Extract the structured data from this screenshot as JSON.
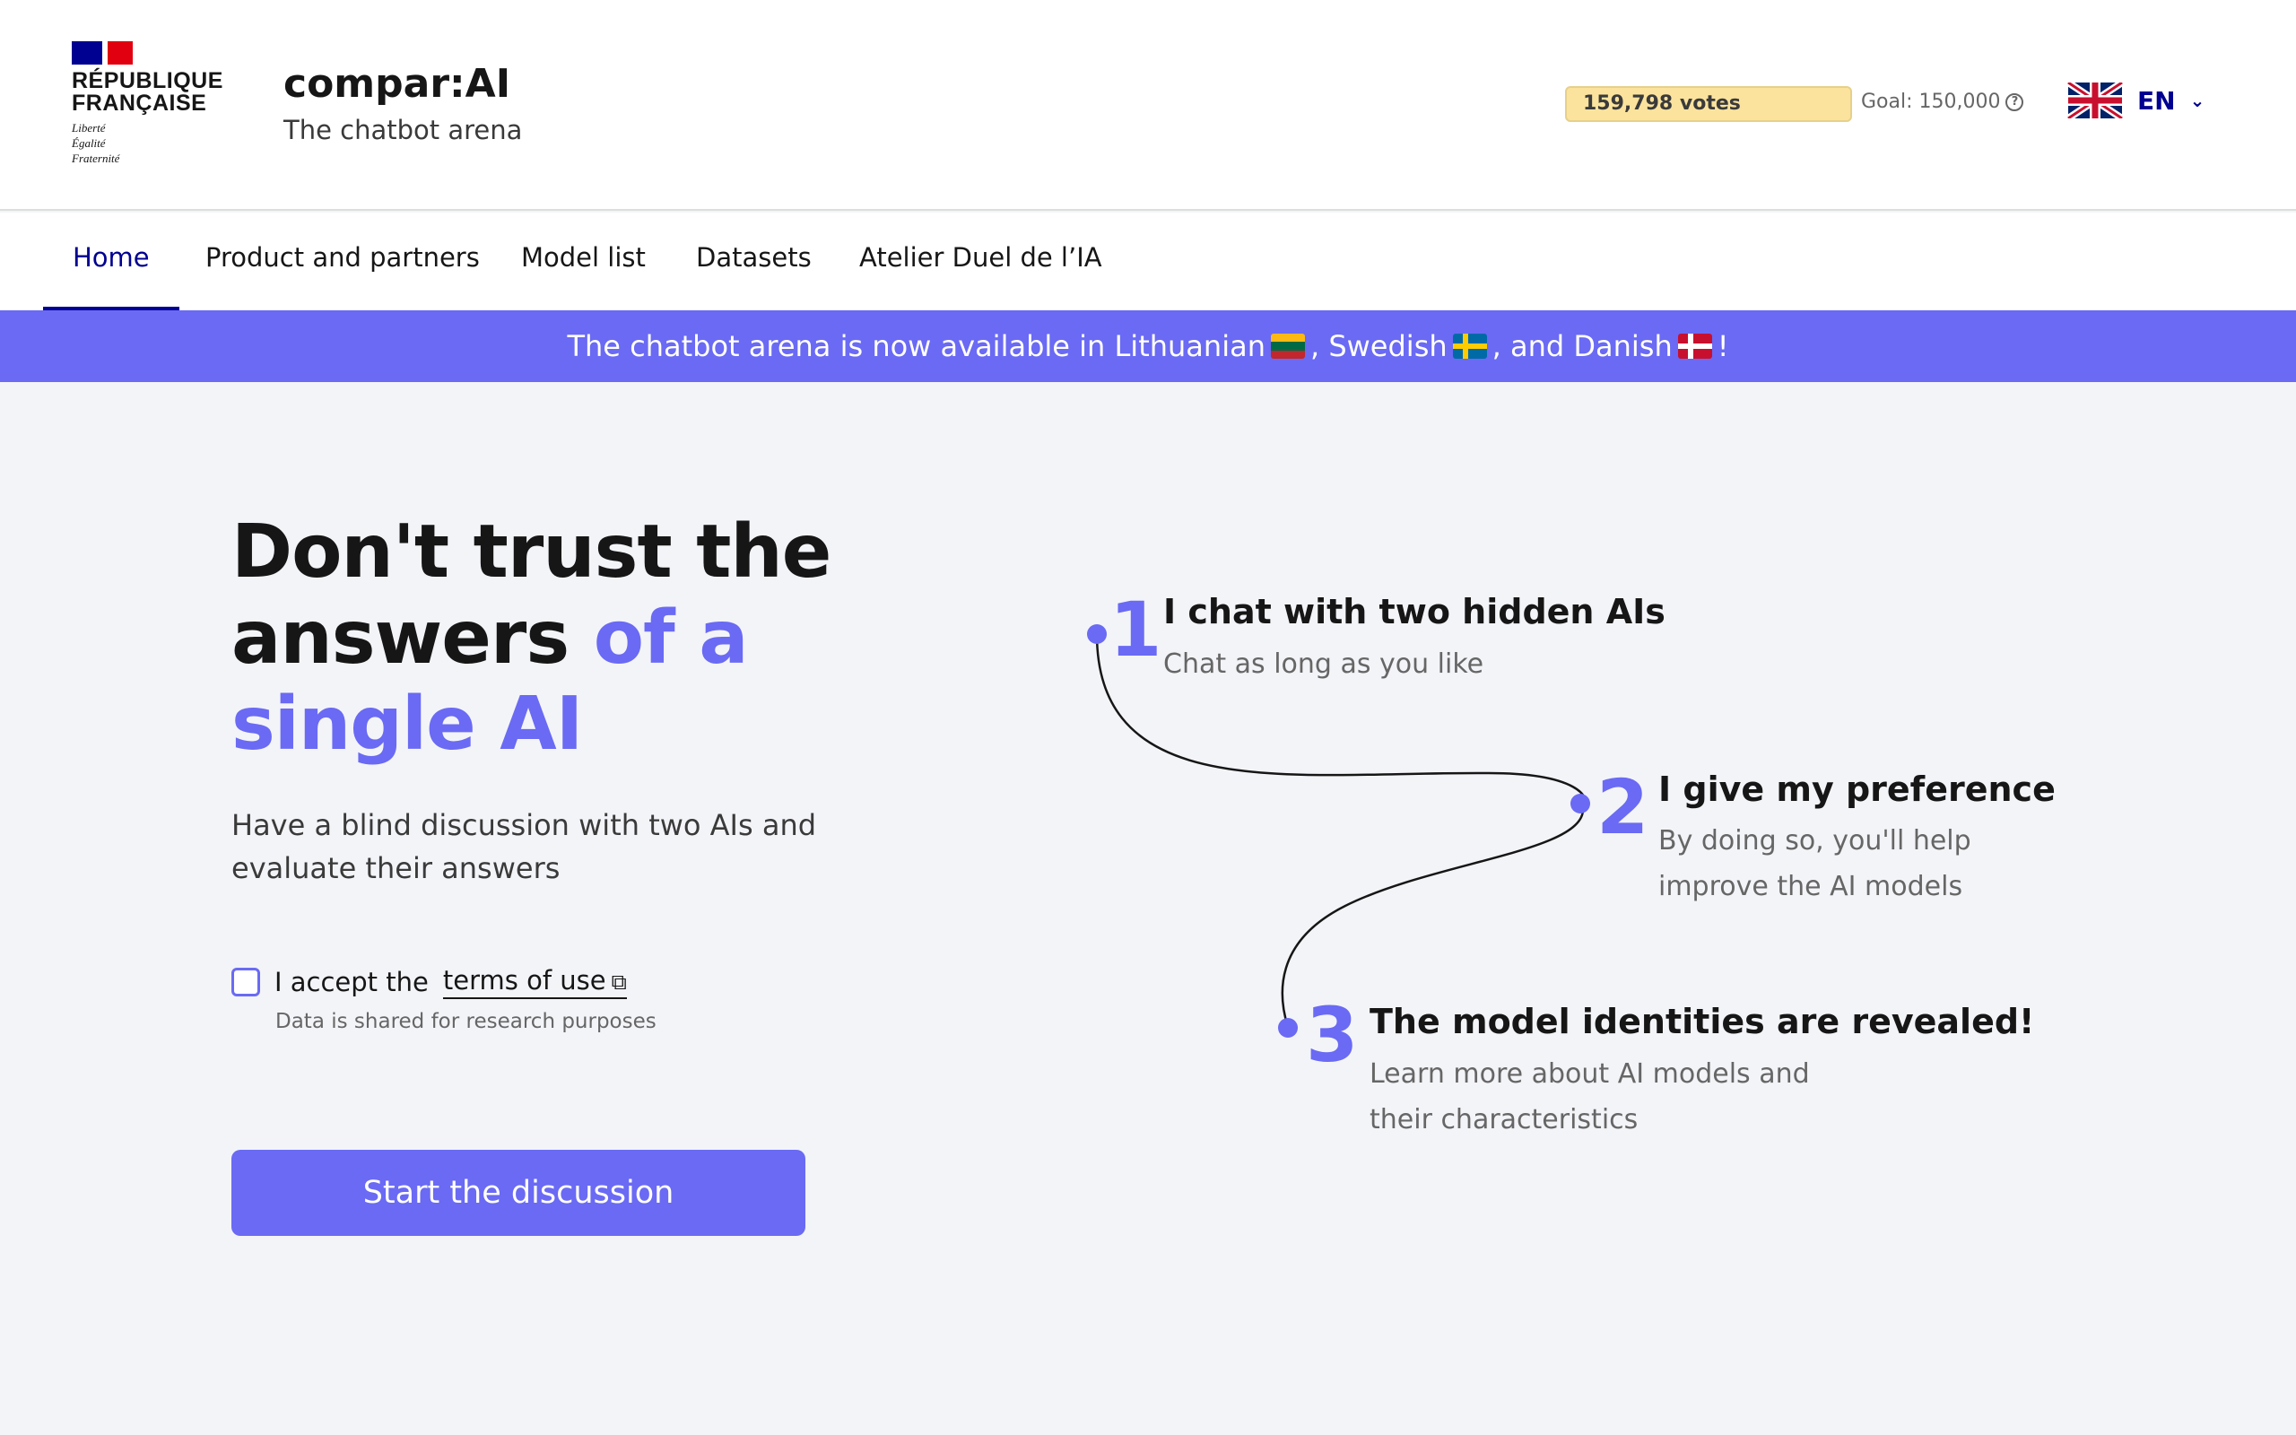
{
  "header": {
    "gov_logo": {
      "name_line1": "RÉPUBLIQUE",
      "name_line2": "FRANÇAISE",
      "motto1": "Liberté",
      "motto2": "Égalité",
      "motto3": "Fraternité"
    },
    "title": "compar:AI",
    "tagline": "The chatbot arena",
    "votes_label": "159,798 votes",
    "votes_progress": 1.0,
    "goal_label": "Goal: 150,000",
    "help_icon": "help-icon",
    "language": {
      "label": "EN",
      "icon": "uk-flag-icon",
      "chevron": "chevron-down-icon"
    }
  },
  "nav": {
    "items": [
      {
        "label": "Home",
        "active": true
      },
      {
        "label": "Product and partners"
      },
      {
        "label": "Model list"
      },
      {
        "label": "Datasets"
      },
      {
        "label": "Atelier Duel de l’IA"
      }
    ]
  },
  "banner": {
    "part1": "The chatbot arena is now available in Lithuanian",
    "part2": ", Swedish",
    "part3": ", and Danish",
    "part4": "!"
  },
  "hero": {
    "title_plain": "Don't trust the answers",
    "title_accent": "of a single AI",
    "subtitle": "Have a blind discussion with two AIs and evaluate their answers",
    "terms_prefix": "I accept the",
    "terms_link": "terms of use",
    "terms_note": "Data is shared for research purposes",
    "start_button": "Start the discussion"
  },
  "steps": [
    {
      "number": "1",
      "title": "I chat with two hidden AIs",
      "desc": "Chat as long as you like"
    },
    {
      "number": "2",
      "title": "I give my preference",
      "desc": "By doing so, you'll help improve the AI models"
    },
    {
      "number": "3",
      "title": "The model identities are revealed!",
      "desc": "Learn more about AI models and their characteristics"
    }
  ],
  "colors": {
    "accent": "#6a6af4",
    "nav_active": "#000091",
    "votes_bg": "#fbe39d",
    "page_bg": "#f3f4f8"
  }
}
